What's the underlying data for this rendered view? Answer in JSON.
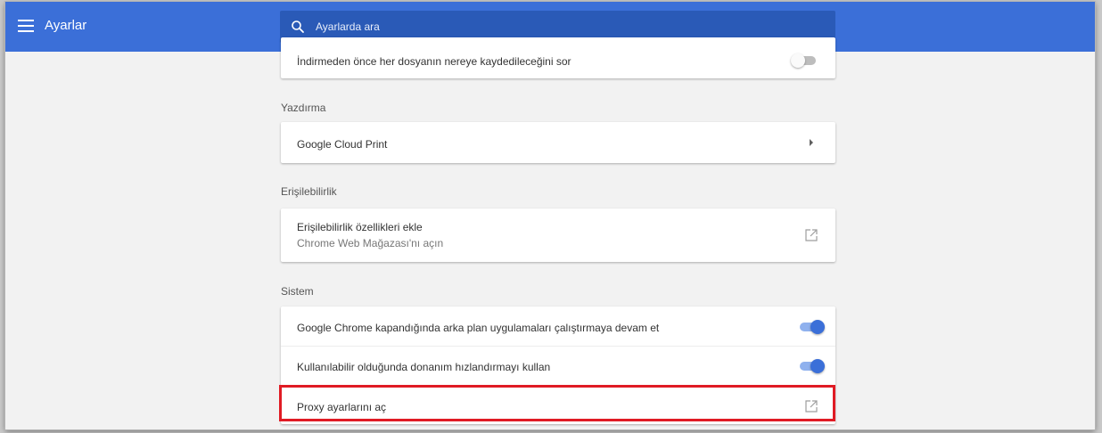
{
  "header": {
    "title": "Ayarlar",
    "search_placeholder": "Ayarlarda ara"
  },
  "downloads": {
    "ask_label": "İndirmeden önce her dosyanın nereye kaydedileceğini sor",
    "ask_enabled": false
  },
  "printing": {
    "section_title": "Yazdırma",
    "cloud_print_label": "Google Cloud Print"
  },
  "accessibility": {
    "section_title": "Erişilebilirlik",
    "add_features_label": "Erişilebilirlik özellikleri ekle",
    "add_features_sub": "Chrome Web Mağazası'nı açın"
  },
  "system": {
    "section_title": "Sistem",
    "background_apps_label": "Google Chrome kapandığında arka plan uygulamaları çalıştırmaya devam et",
    "background_apps_enabled": true,
    "hardware_accel_label": "Kullanılabilir olduğunda donanım hızlandırmayı kullan",
    "hardware_accel_enabled": true,
    "proxy_label": "Proxy ayarlarını aç"
  },
  "colors": {
    "accent": "#3b6fd8",
    "highlight": "#e01b24"
  }
}
